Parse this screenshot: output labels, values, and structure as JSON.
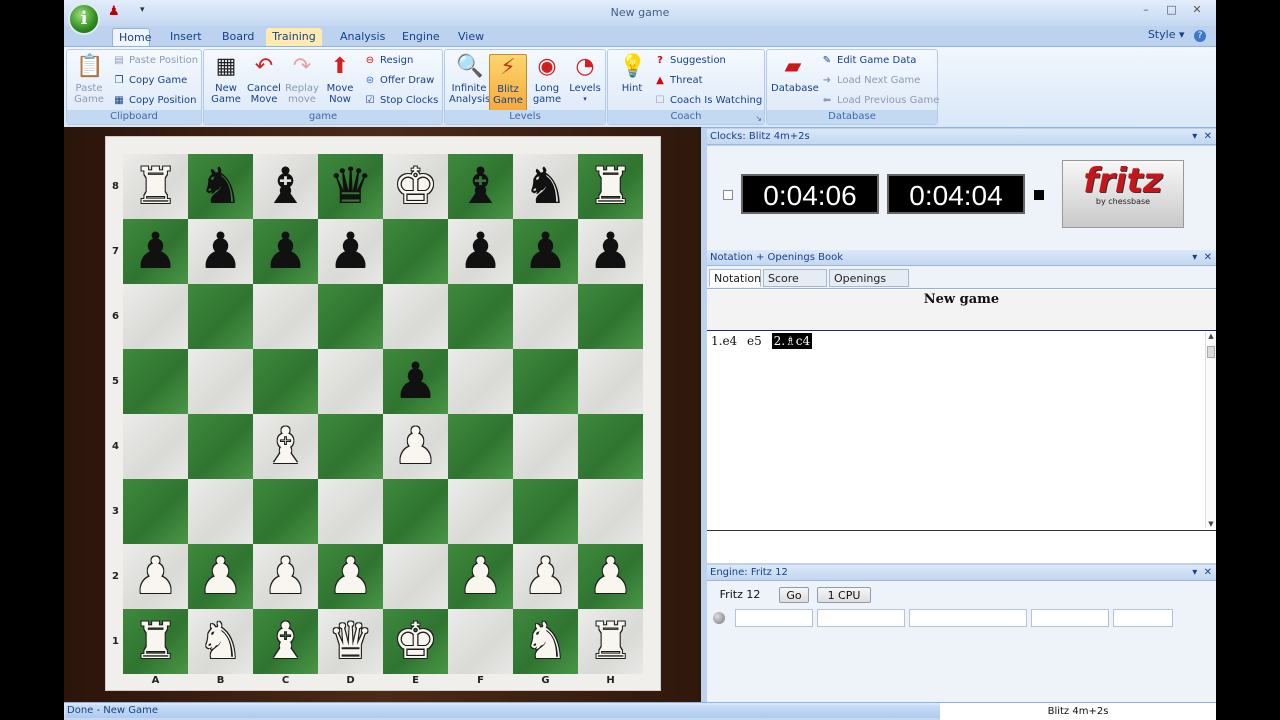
{
  "window": {
    "title": "New game",
    "orb_icon": "fritz-orb-icon",
    "controls": [
      "–",
      "□",
      "✕"
    ]
  },
  "ribbon_tabs": [
    {
      "label": "Home",
      "active": true
    },
    {
      "label": "Insert"
    },
    {
      "label": "Board"
    },
    {
      "label": "Training",
      "hover": true
    },
    {
      "label": "Analysis"
    },
    {
      "label": "Engine"
    },
    {
      "label": "View"
    }
  ],
  "style_menu": "Style",
  "groups": {
    "clipboard": {
      "label": "Clipboard",
      "paste_game": "Paste\nGame",
      "paste_position": "Paste Position",
      "copy_game": "Copy Game",
      "copy_position": "Copy Position"
    },
    "game": {
      "label": "game",
      "new_game": "New\nGame",
      "cancel_move": "Cancel\nMove",
      "replay_move": "Replay\nmove",
      "move_now": "Move\nNow",
      "resign": "Resign",
      "offer_draw": "Offer Draw",
      "stop_clocks": "Stop Clocks"
    },
    "levels": {
      "label": "Levels",
      "infinite_analysis": "Infinite\nAnalysis",
      "blitz_game": "Blitz\nGame",
      "long_game": "Long\ngame",
      "levels": "Levels"
    },
    "coach": {
      "label": "Coach",
      "hint": "Hint",
      "suggestion": "Suggestion",
      "threat": "Threat",
      "coach_watching": "Coach Is Watching"
    },
    "database": {
      "label": "Database",
      "database": "Database",
      "edit_game_data": "Edit Game Data",
      "load_next": "Load Next Game",
      "load_previous": "Load Previous Game"
    }
  },
  "board": {
    "files": [
      "A",
      "B",
      "C",
      "D",
      "E",
      "F",
      "G",
      "H"
    ],
    "ranks": [
      "8",
      "7",
      "6",
      "5",
      "4",
      "3",
      "2",
      "1"
    ],
    "position": [
      [
        "wr",
        "bn",
        "bb",
        "bq",
        "wk",
        "bb",
        "bn",
        "wr"
      ],
      [
        "bp",
        "bp",
        "bp",
        "bp",
        "",
        "bp",
        "bp",
        "bp"
      ],
      [
        "",
        "",
        "",
        "",
        "",
        "",
        "",
        ""
      ],
      [
        "",
        "",
        "",
        "",
        "bp",
        "",
        "",
        ""
      ],
      [
        "",
        "",
        "wb",
        "",
        "wp",
        "",
        "",
        ""
      ],
      [
        "",
        "",
        "",
        "",
        "",
        "",
        "",
        ""
      ],
      [
        "wp",
        "wp",
        "wp",
        "wp",
        "",
        "wp",
        "wp",
        "wp"
      ],
      [
        "wr",
        "wn",
        "wb",
        "wq",
        "wk",
        "",
        "wn",
        "wr"
      ]
    ]
  },
  "clocks": {
    "header": "Clocks: Blitz 4m+2s",
    "white_time": "0:04:06",
    "black_time": "0:04:04",
    "logo_text": "fritz",
    "logo_sub": "by chessbase"
  },
  "notation": {
    "header": "Notation + Openings Book",
    "tabs": [
      "Notation",
      "Score sheet",
      "Openings Book"
    ],
    "game_title": "New game",
    "moves": [
      "1.e4",
      "e5",
      "2.♗c4"
    ]
  },
  "engine": {
    "header": "Engine: Fritz 12",
    "name": "Fritz 12",
    "go": "Go",
    "cpu": "1 CPU"
  },
  "status": {
    "left": "Done - New Game",
    "right": "Blitz 4m+2s"
  }
}
